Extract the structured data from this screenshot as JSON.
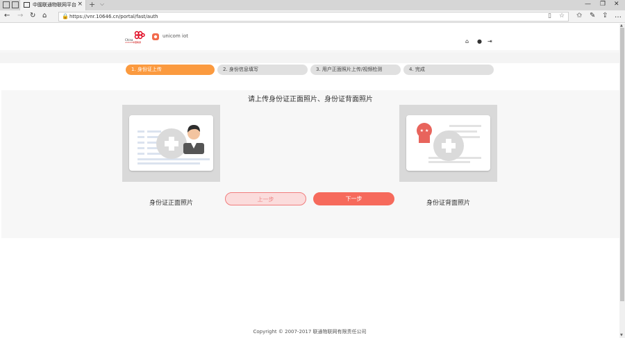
{
  "browser": {
    "tab_title": "中國联通物联网平台",
    "url": "https://vnr.10646.cn/portal/fast/auth",
    "new_tab": "+",
    "close": "×"
  },
  "header": {
    "logo_text_line1": "China",
    "logo_text_line2": "unicom中国联通",
    "brand": "unicom iot"
  },
  "steps": [
    {
      "label": "1.  身份证上传",
      "active": true
    },
    {
      "label": "2.  身份信息填写",
      "active": false
    },
    {
      "label": "3.  用户正面照片上传/视频检测",
      "active": false
    },
    {
      "label": "4.  完成",
      "active": false
    }
  ],
  "upload": {
    "title": "请上传身份证正面照片、身份证背面照片",
    "front_label": "身份证正面照片",
    "back_label": "身份证背面照片"
  },
  "buttons": {
    "prev": "上一步",
    "next": "下一步"
  },
  "footer": {
    "copyright": "Copyright © 2007-2017 联通物联网有限责任公司"
  },
  "colors": {
    "active_step": "#fb9a3f",
    "next_button": "#f66a5c",
    "brand_red": "#e0001b"
  }
}
